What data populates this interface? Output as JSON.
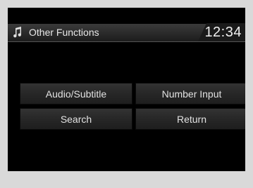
{
  "header": {
    "title": "Other Functions",
    "clock": "12:34",
    "icon": "music-note-icon"
  },
  "menu": {
    "buttons": [
      {
        "label": "Audio/Subtitle"
      },
      {
        "label": "Number Input"
      },
      {
        "label": "Search"
      },
      {
        "label": "Return"
      }
    ]
  },
  "colors": {
    "screen_background": "#000000",
    "page_background": "#d9d9d9",
    "button_text": "#e2e2e2"
  }
}
